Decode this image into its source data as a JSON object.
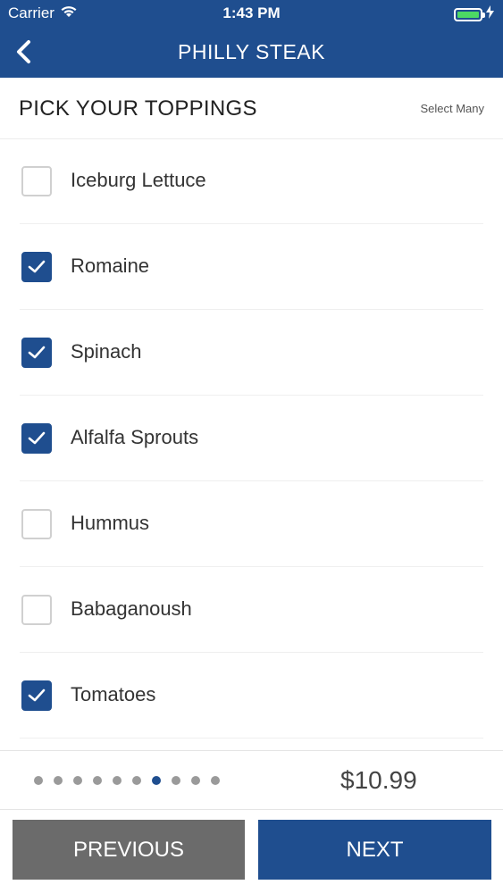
{
  "status_bar": {
    "carrier": "Carrier",
    "time": "1:43 PM"
  },
  "nav": {
    "title": "PHILLY STEAK",
    "back_icon": "chevron-left-icon"
  },
  "section": {
    "title": "PICK YOUR TOPPINGS",
    "hint": "Select Many"
  },
  "toppings": [
    {
      "label": "Iceburg Lettuce",
      "checked": false
    },
    {
      "label": "Romaine",
      "checked": true
    },
    {
      "label": "Spinach",
      "checked": true
    },
    {
      "label": "Alfalfa Sprouts",
      "checked": true
    },
    {
      "label": "Hummus",
      "checked": false
    },
    {
      "label": "Babaganoush",
      "checked": false
    },
    {
      "label": "Tomatoes",
      "checked": true
    }
  ],
  "pager": {
    "total": 10,
    "current_index": 6
  },
  "price": "$10.99",
  "buttons": {
    "previous": "PREVIOUS",
    "next": "NEXT"
  },
  "colors": {
    "brand": "#1f4e8f",
    "secondary_button": "#6b6b6b",
    "battery": "#4cd964"
  }
}
